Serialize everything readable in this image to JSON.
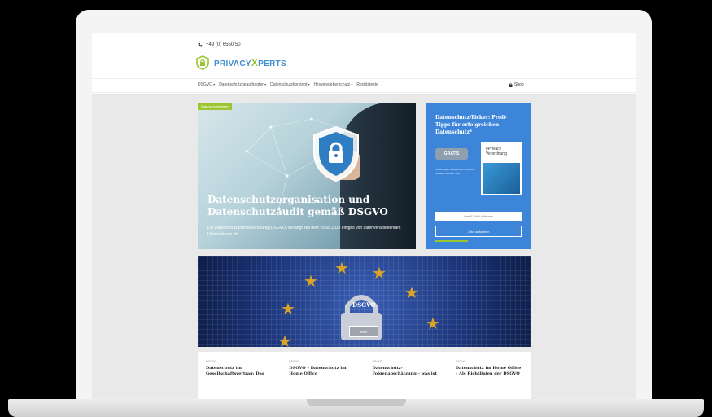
{
  "header": {
    "phone": "+49 (0) 6550 50",
    "logo": {
      "part1": "PRIVACY",
      "x": "X",
      "part2": "PERTS"
    }
  },
  "nav": {
    "items": [
      {
        "label": "DSGVO",
        "dropdown": true
      },
      {
        "label": "Datenschutzbeauftragter",
        "dropdown": true
      },
      {
        "label": "Datenschutzkonzept",
        "dropdown": true
      },
      {
        "label": "Hinweisgeberschutz",
        "dropdown": true
      },
      {
        "label": "Rechtstexte",
        "dropdown": false
      }
    ],
    "shop": "Shop"
  },
  "hero": {
    "tag": "Datenschutzwissen",
    "title": "Datenschutzorganisation und Datenschutzaudit gemäß DSGVO",
    "description": "Die Datenschutzgrundverordnung (DSGVO) verlangt seit dem 25.05.2018 einiges von datenverarbeitenden Unternehmen ab ..."
  },
  "sidebar": {
    "headline": "Datenschutz-Ticker: Profi-Tipps für erfolgreichen Datenschutz*",
    "gratis": "GRATIS",
    "book_title": "ePrivacy Verordnung",
    "small_text": "Mit wichtigen Datenschutz-Infos und Updates aus aller Welt",
    "email_placeholder": "Ihre E-Mail-Adresse",
    "button": "Jetzt anfordern"
  },
  "eu_banner": {
    "label": "DSGVO",
    "more": "Mehr"
  },
  "cards": [
    {
      "category": "DSGVO",
      "title": "Datenschutz im Gesellschaftsvertrag: Das"
    },
    {
      "category": "DSGVO",
      "title": "DSGVO – Datenschutz im Home Office"
    },
    {
      "category": "DSGVO",
      "title": "Datenschutz-Folgenabschätzung – was ist"
    },
    {
      "category": "DSGVO",
      "title": "Datenschutz im Home Office – Als Richtlinien der DSGVO"
    }
  ],
  "colors": {
    "brand_blue": "#3c85d8",
    "brand_green": "#9cc531",
    "eu_gold": "#d9a428"
  }
}
